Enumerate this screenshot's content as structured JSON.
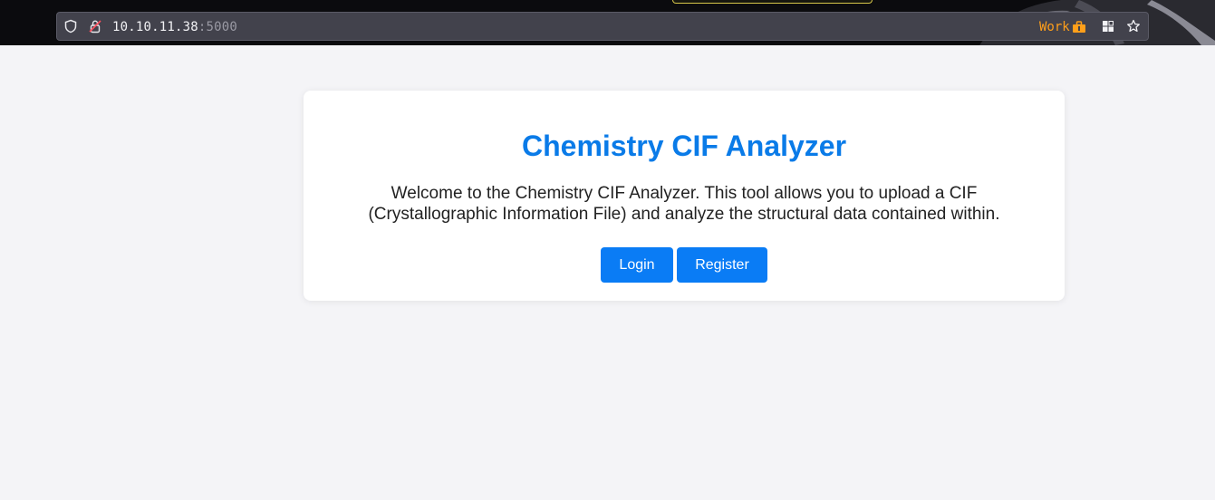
{
  "browser": {
    "url_host": "10.10.11.38",
    "url_port": ":5000",
    "container_label": "Work",
    "icons": [
      "shield-icon",
      "lock-icon",
      "briefcase-icon",
      "extensions-icon",
      "star-icon"
    ],
    "container_color": "#ff9f1a"
  },
  "page": {
    "title": "Chemistry CIF Analyzer",
    "description": "Welcome to the Chemistry CIF Analyzer. This tool allows you to upload a CIF (Crystallographic Information File) and analyze the structural data contained within.",
    "login_label": "Login",
    "register_label": "Register",
    "accent_color": "#0a7be8"
  }
}
